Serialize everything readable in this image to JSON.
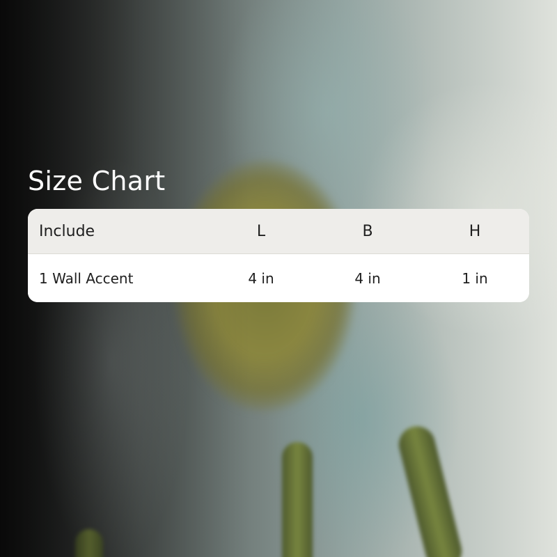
{
  "title": "Size Chart",
  "table": {
    "headers": [
      "Include",
      "L",
      "B",
      "H"
    ],
    "rows": [
      [
        "1 Wall Accent",
        "4 in",
        "4 in",
        "1 in"
      ]
    ]
  }
}
